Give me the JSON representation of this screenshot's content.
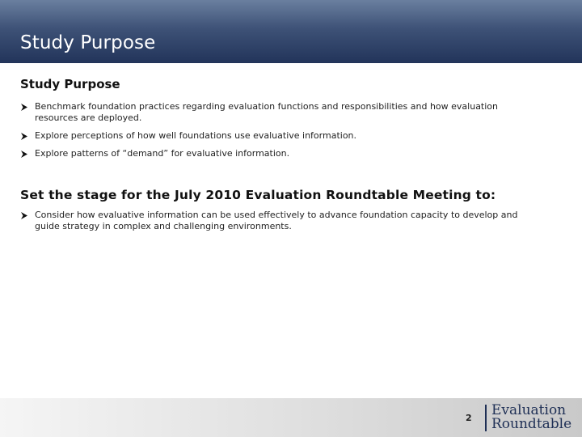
{
  "header": {
    "title": "Study Purpose",
    "colors": {
      "bar_light": "#6a7f9f",
      "bar_dark": "#22345a"
    }
  },
  "sections": [
    {
      "heading": "Study Purpose",
      "bullets": [
        "Benchmark foundation practices regarding evaluation functions and responsibilities and how evaluation resources are deployed.",
        "Explore perceptions of how well foundations use evaluative information.",
        "Explore patterns of “demand” for evaluative information."
      ]
    },
    {
      "heading": "Set the stage for the July 2010 Evaluation Roundtable Meeting to:",
      "bullets": [
        "Consider how evaluative information can be used effectively to advance foundation capacity to develop and guide strategy in complex and challenging environments."
      ]
    }
  ],
  "footer": {
    "page_number": "2",
    "logo_line1": "Evaluation",
    "logo_line2": "Roundtable",
    "logo_color": "#1e2f55"
  },
  "icons": {
    "bullet": "arrowhead-icon"
  }
}
